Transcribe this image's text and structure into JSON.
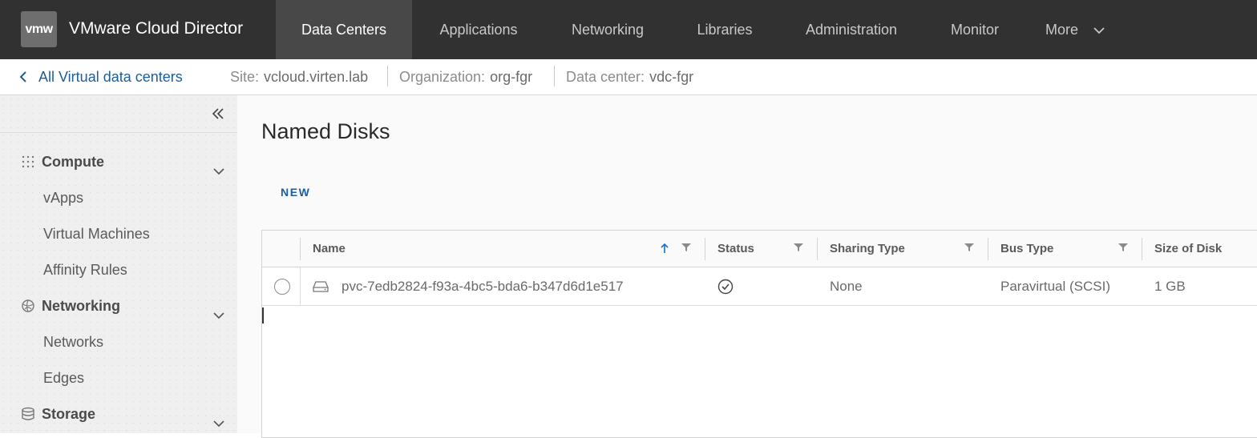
{
  "header": {
    "logo_text": "vmw",
    "app_title": "VMware Cloud Director",
    "nav": [
      {
        "label": "Data Centers",
        "active": true
      },
      {
        "label": "Applications",
        "active": false
      },
      {
        "label": "Networking",
        "active": false
      },
      {
        "label": "Libraries",
        "active": false
      },
      {
        "label": "Administration",
        "active": false
      },
      {
        "label": "Monitor",
        "active": false
      },
      {
        "label": "More",
        "active": false
      }
    ]
  },
  "breadcrumb": {
    "back_label": "All Virtual data centers",
    "site_label": "Site:",
    "site_value": "vcloud.virten.lab",
    "org_label": "Organization:",
    "org_value": "org-fgr",
    "dc_label": "Data center:",
    "dc_value": "vdc-fgr"
  },
  "sidebar": {
    "sections": [
      {
        "label": "Compute",
        "icon": "grid-dots-icon",
        "items": [
          "vApps",
          "Virtual Machines",
          "Affinity Rules"
        ]
      },
      {
        "label": "Networking",
        "icon": "globe-icon",
        "items": [
          "Networks",
          "Edges"
        ]
      },
      {
        "label": "Storage",
        "icon": "database-icon",
        "items": []
      }
    ]
  },
  "main": {
    "title": "Named Disks",
    "new_button": "NEW",
    "columns": [
      "Name",
      "Status",
      "Sharing Type",
      "Bus Type",
      "Size of Disk"
    ],
    "rows": [
      {
        "name": "pvc-7edb2824-f93a-4bc5-bda6-b347d6d1e517",
        "status": "ok",
        "sharing_type": "None",
        "bus_type": "Paravirtual (SCSI)",
        "size": "1 GB"
      }
    ]
  },
  "colors": {
    "header_bg": "#313131",
    "active_tab": "#484848",
    "link": "#1b5e9c"
  }
}
